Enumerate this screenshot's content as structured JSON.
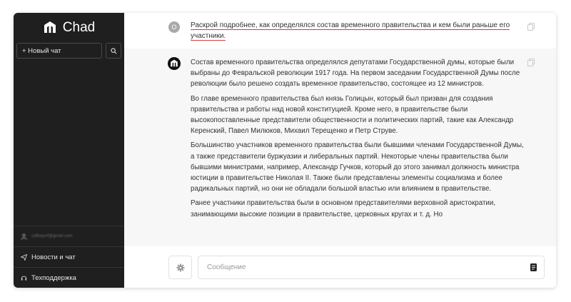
{
  "sidebar": {
    "logo_text": "Chad",
    "new_chat_label": "+ Новый чат",
    "email": "cid8ayvrf@gmail.com",
    "news_label": "Новости и чат",
    "support_label": "Техподдержка"
  },
  "user_message": {
    "avatar_letter": "О",
    "text": "Раскрой подробнее, как определялся состав временного правительства и кем были раньше его участники."
  },
  "bot_message": {
    "paragraphs": [
      "Состав временного правительства определялся депутатами Государственной думы, которые были выбраны до Февральской революции 1917 года. На первом заседании Государственной Думы после революции было решено создать временное правительство, состоящее из 12 министров.",
      "Во главе временного правительства был князь Голицын, который был призван для создания правительства и работы над новой конституцией. Кроме него, в правительстве были высокопоставленные представители общественности и политических партий, такие как Александр Керенский, Павел Милюков, Михаил Терещенко и Петр Струве.",
      "Большинство участников временного правительства были бывшими членами Государственной Думы, а также представители буржуазии и либеральных партий. Некоторые члены правительства были бывшими министрами, например, Александр Гучков, который до этого занимал должность министра юстиции в правительстве Николая II. Также были представлены элементы социализма и более радикальных партий, но они не обладали большой властью или влиянием в правительстве.",
      "Ранее участники правительства были в основном представителями верховной аристократии, занимающими высокие позиции в правительстве, церковных кругах и т. д. Но"
    ]
  },
  "composer": {
    "placeholder": "Сообщение"
  }
}
